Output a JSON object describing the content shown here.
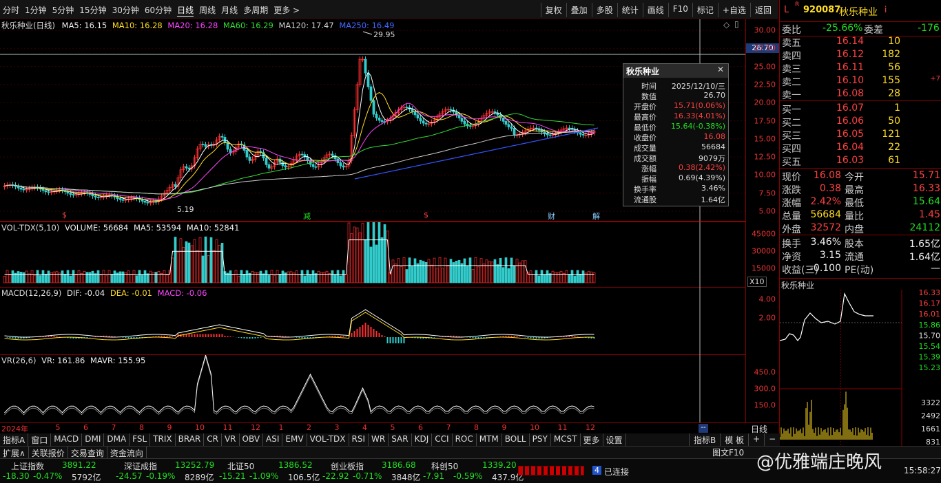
{
  "toolbar": {
    "periods": [
      "分时",
      "1分钟",
      "5分钟",
      "15分钟",
      "30分钟",
      "60分钟",
      "日线",
      "周线",
      "月线",
      "多周期",
      "更多 >"
    ],
    "active": "日线",
    "right": [
      "复权",
      "叠加",
      "多股",
      "统计",
      "画线",
      "F10",
      "标记",
      "+自选",
      "返回"
    ]
  },
  "main": {
    "title": "秋乐种业(日线)",
    "ma5": "MA5: 16.15",
    "ma10": "MA10: 16.28",
    "ma20": "MA20: 16.28",
    "ma60": "MA60: 16.29",
    "ma120": "MA120: 17.47",
    "ma250": "MA250: 16.49",
    "high_label": "29.95",
    "low_label": "5.19",
    "crosshair_price": "26.70",
    "yticks": [
      "30.00",
      "27.50",
      "25.00",
      "22.50",
      "20.00",
      "17.50",
      "15.00",
      "12.50",
      "10.00",
      "7.50",
      "5.00"
    ],
    "markers": [
      "$",
      "减",
      "$",
      "财",
      "解"
    ]
  },
  "vol": {
    "title": "VOL-TDX(5,10)",
    "volume": "VOLUME: 56684",
    "ma5": "MA5: 53594",
    "ma10": "MA10: 52841",
    "yticks": [
      "45000",
      "30000",
      "15000"
    ],
    "unit": "X10"
  },
  "macd": {
    "title": "MACD(12,26,9)",
    "dif": "DIF: -0.04",
    "dea": "DEA: -0.01",
    "macd": "MACD: -0.06",
    "yticks": [
      "4.00",
      "2.00"
    ]
  },
  "vr": {
    "title": "VR(26,6)",
    "vr": "VR: 161.86",
    "mavr": "MAVR: 155.95",
    "yticks": [
      "450.0",
      "300.0",
      "150.0"
    ]
  },
  "xaxis": {
    "labels": [
      "2024年",
      "5",
      "6",
      "7",
      "8",
      "9",
      "10",
      "11",
      "12",
      "1",
      "2",
      "3",
      "4",
      "5",
      "6",
      "7",
      "8",
      "9",
      "10",
      "11",
      "12"
    ],
    "right_label": "日线"
  },
  "popup": {
    "title": "秋乐种业",
    "rows": [
      {
        "k": "时间",
        "v": "2025/12/10/三",
        "c": "#ddd"
      },
      {
        "k": "数值",
        "v": "26.70",
        "c": "#ddd"
      },
      {
        "k": "开盘价",
        "v": "15.71(0.06%)",
        "c": "#ff4040"
      },
      {
        "k": "最高价",
        "v": "16.33(4.01%)",
        "c": "#ff4040"
      },
      {
        "k": "最低价",
        "v": "15.64(-0.38%)",
        "c": "#22dd22"
      },
      {
        "k": "收盘价",
        "v": "16.08",
        "c": "#ff4040"
      },
      {
        "k": "成交量",
        "v": "56684",
        "c": "#ddd"
      },
      {
        "k": "成交额",
        "v": "9079万",
        "c": "#ddd"
      },
      {
        "k": "涨幅",
        "v": "0.38(2.42%)",
        "c": "#ff4040"
      },
      {
        "k": "振幅",
        "v": "0.69(4.39%)",
        "c": "#ddd"
      },
      {
        "k": "换手率",
        "v": "3.46%",
        "c": "#ddd"
      },
      {
        "k": "流通股",
        "v": "1.64亿",
        "c": "#ddd"
      }
    ]
  },
  "quote": {
    "code": "920087",
    "name": "秋乐种业",
    "flag_l": "L",
    "flag_r": "R",
    "flag_i": "i",
    "weibi_label": "委比",
    "weibi": "-25.66%",
    "weicha_label": "委差",
    "weicha": "-176",
    "asks": [
      {
        "l": "卖五",
        "p": "16.14",
        "v": "10"
      },
      {
        "l": "卖四",
        "p": "16.12",
        "v": "182"
      },
      {
        "l": "卖三",
        "p": "16.11",
        "v": "56"
      },
      {
        "l": "卖二",
        "p": "16.10",
        "v": "155",
        "x": "+7"
      },
      {
        "l": "卖一",
        "p": "16.08",
        "v": "28"
      }
    ],
    "bids": [
      {
        "l": "买一",
        "p": "16.07",
        "v": "1"
      },
      {
        "l": "买二",
        "p": "16.06",
        "v": "50"
      },
      {
        "l": "买三",
        "p": "16.05",
        "v": "121"
      },
      {
        "l": "买四",
        "p": "16.04",
        "v": "22"
      },
      {
        "l": "买五",
        "p": "16.03",
        "v": "61"
      }
    ],
    "stats": [
      {
        "a": "现价",
        "av": "16.08",
        "ac": "red",
        "b": "今开",
        "bv": "15.71",
        "bc": "red"
      },
      {
        "a": "涨跌",
        "av": "0.38",
        "ac": "red",
        "b": "最高",
        "bv": "16.33",
        "bc": "red"
      },
      {
        "a": "涨幅",
        "av": "2.42%",
        "ac": "red",
        "b": "最低",
        "bv": "15.64",
        "bc": "grn"
      },
      {
        "a": "总量",
        "av": "56684",
        "ac": "yel",
        "b": "量比",
        "bv": "1.45",
        "bc": "red"
      },
      {
        "a": "外盘",
        "av": "32572",
        "ac": "red",
        "b": "内盘",
        "bv": "24112",
        "bc": "grn"
      }
    ],
    "stats2": [
      {
        "a": "换手",
        "av": "3.46%",
        "b": "股本",
        "bv": "1.65亿"
      },
      {
        "a": "净资",
        "av": "3.15",
        "b": "流通",
        "bv": "1.64亿"
      },
      {
        "a": "收益(三)",
        "av": "-0.100",
        "b": "PE(动)",
        "bv": "—"
      }
    ],
    "mini_title": "秋乐种业",
    "mini_yticks": [
      "16.33",
      "16.17",
      "16.01",
      "15.86",
      "15.70",
      "15.54",
      "15.39",
      "15.23"
    ],
    "mini_vticks": [
      "3322",
      "2492",
      "1661",
      "831"
    ]
  },
  "tabs": [
    "指标A",
    "窗口",
    "MACD",
    "DMI",
    "DMA",
    "FSL",
    "TRIX",
    "BRAR",
    "CR",
    "VR",
    "OBV",
    "ASI",
    "EMV",
    "VOL-TDX",
    "RSI",
    "WR",
    "SAR",
    "KDJ",
    "CCI",
    "ROC",
    "MTM",
    "BOLL",
    "PSY",
    "MCST",
    "更多",
    "设置"
  ],
  "tabs_right": [
    "指标B",
    "模 板",
    "+",
    "−"
  ],
  "tabs2": [
    "扩展∧",
    "关联报价",
    "交易查询",
    "资金流向"
  ],
  "tabs2_right": "图文F10",
  "indices": [
    {
      "n": "上证指数",
      "v": "3891.22",
      "c": "-18.30",
      "p": "-0.47%",
      "a": "5792亿"
    },
    {
      "n": "深证成指",
      "v": "13252.79",
      "c": "-24.57",
      "p": "-0.19%",
      "a": "8289亿"
    },
    {
      "n": "北证50",
      "v": "1386.52",
      "c": "-15.21",
      "p": "-1.09%",
      "a": "106.5亿"
    },
    {
      "n": "创业板指",
      "v": "3186.68",
      "c": "-22.92",
      "p": "-0.71%",
      "a": "3848亿"
    },
    {
      "n": "科创50",
      "v": "1339.20",
      "c": "-7.91",
      "p": "-0.59%",
      "a": "437.9亿"
    }
  ],
  "status": {
    "conn_num": "4",
    "conn": "已连接",
    "time": "15:58:27",
    "watermark": "@优雅端庄晚风"
  }
}
